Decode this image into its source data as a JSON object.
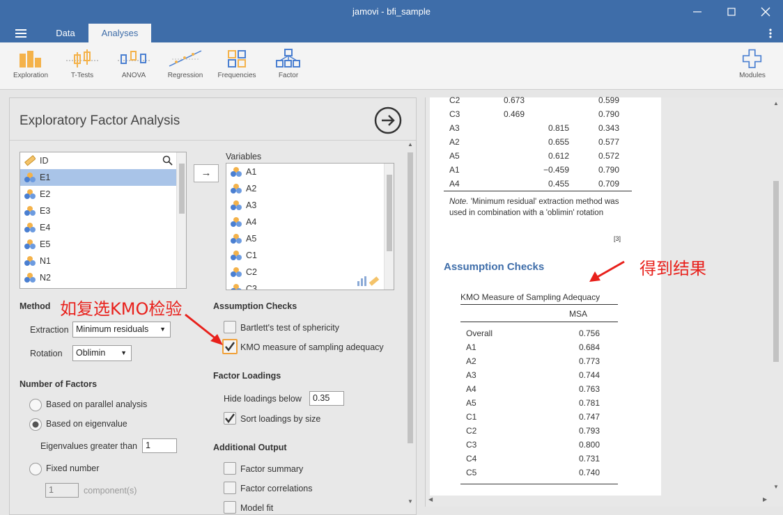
{
  "window": {
    "title": "jamovi - bfi_sample"
  },
  "tabs": [
    {
      "label": "Data"
    },
    {
      "label": "Analyses"
    }
  ],
  "ribbon": {
    "tools": [
      {
        "label": "Exploration",
        "icon": "exploration-icon"
      },
      {
        "label": "T-Tests",
        "icon": "ttests-icon"
      },
      {
        "label": "ANOVA",
        "icon": "anova-icon"
      },
      {
        "label": "Regression",
        "icon": "regression-icon"
      },
      {
        "label": "Frequencies",
        "icon": "frequencies-icon"
      },
      {
        "label": "Factor",
        "icon": "factor-icon"
      }
    ],
    "modules_label": "Modules"
  },
  "analysis": {
    "title": "Exploratory Factor Analysis"
  },
  "source_list": {
    "items": [
      "ID",
      "E1",
      "E2",
      "E3",
      "E4",
      "E5",
      "N1",
      "N2"
    ],
    "selected": "E1"
  },
  "variables": {
    "header": "Variables",
    "items": [
      "A1",
      "A2",
      "A3",
      "A4",
      "A5",
      "C1",
      "C2",
      "C3"
    ]
  },
  "method": {
    "heading": "Method",
    "extraction_label": "Extraction",
    "extraction_value": "Minimum residuals",
    "rotation_label": "Rotation",
    "rotation_value": "Oblimin"
  },
  "number_of_factors": {
    "heading": "Number of Factors",
    "parallel": "Based on parallel analysis",
    "eigen": "Based on eigenvalue",
    "eigen_gt_label": "Eigenvalues greater than",
    "eigen_gt_value": "1",
    "fixed": "Fixed number",
    "fixed_value": "1",
    "fixed_unit": "component(s)"
  },
  "assumption_checks": {
    "heading": "Assumption Checks",
    "bartlett": "Bartlett's test of sphericity",
    "kmo": "KMO measure of sampling adequacy"
  },
  "factor_loadings": {
    "heading": "Factor Loadings",
    "hide_label": "Hide loadings below",
    "hide_value": "0.35",
    "sort_label": "Sort loadings by size"
  },
  "additional_output": {
    "heading": "Additional Output",
    "summary": "Factor summary",
    "correlations": "Factor correlations",
    "model_fit": "Model fit"
  },
  "annotations": {
    "left": "如复选KMO检验",
    "right": "得到结果",
    "color": "#e8211c"
  },
  "results": {
    "loadings_rows": [
      {
        "name": "C2",
        "f1": "0.673",
        "f2": "",
        "uniq": "0.599"
      },
      {
        "name": "C3",
        "f1": "0.469",
        "f2": "",
        "uniq": "0.790"
      },
      {
        "name": "A3",
        "f1": "",
        "f2": "0.815",
        "uniq": "0.343"
      },
      {
        "name": "A2",
        "f1": "",
        "f2": "0.655",
        "uniq": "0.577"
      },
      {
        "name": "A5",
        "f1": "",
        "f2": "0.612",
        "uniq": "0.572"
      },
      {
        "name": "A1",
        "f1": "",
        "f2": "−0.459",
        "uniq": "0.790"
      },
      {
        "name": "A4",
        "f1": "",
        "f2": "0.455",
        "uniq": "0.709"
      }
    ],
    "note_prefix": "Note.",
    "note_text": " 'Minimum residual' extraction method was used in combination with a 'oblimin' rotation",
    "footnote_ref": "[3]",
    "assumption_heading": "Assumption Checks",
    "kmo_table_title": "KMO Measure of Sampling Adequacy",
    "kmo_col": "MSA",
    "kmo_rows": [
      {
        "name": "Overall",
        "msa": "0.756"
      },
      {
        "name": "A1",
        "msa": "0.684"
      },
      {
        "name": "A2",
        "msa": "0.773"
      },
      {
        "name": "A3",
        "msa": "0.744"
      },
      {
        "name": "A4",
        "msa": "0.763"
      },
      {
        "name": "A5",
        "msa": "0.781"
      },
      {
        "name": "C1",
        "msa": "0.747"
      },
      {
        "name": "C2",
        "msa": "0.793"
      },
      {
        "name": "C3",
        "msa": "0.800"
      },
      {
        "name": "C4",
        "msa": "0.731"
      },
      {
        "name": "C5",
        "msa": "0.740"
      }
    ]
  }
}
